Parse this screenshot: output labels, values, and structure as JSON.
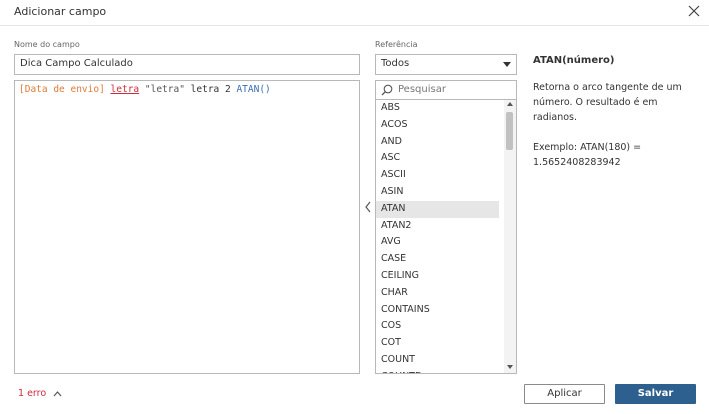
{
  "dialog": {
    "title": "Adicionar campo",
    "close_icon": "close-icon"
  },
  "field_name": {
    "label": "Nome do campo",
    "value": "Dica Campo Calculado"
  },
  "formula": {
    "tokens": [
      {
        "text": "[Data de envio]",
        "kind": "field"
      },
      {
        "text": "letra",
        "kind": "error"
      },
      {
        "text": "\"letra\"",
        "kind": "string"
      },
      {
        "text": "letra 2",
        "kind": "plain"
      },
      {
        "text": "ATAN()",
        "kind": "function"
      }
    ]
  },
  "reference": {
    "label": "Referência",
    "selected": "Todos",
    "search_placeholder": "Pesquisar",
    "functions": [
      "ABS",
      "ACOS",
      "AND",
      "ASC",
      "ASCII",
      "ASIN",
      "ATAN",
      "ATAN2",
      "AVG",
      "CASE",
      "CEILING",
      "CHAR",
      "CONTAINS",
      "COS",
      "COT",
      "COUNT",
      "COUNTD"
    ],
    "selected_function": "ATAN"
  },
  "help": {
    "title": "ATAN(número)",
    "body": "Retorna o arco tangente de um número.  O resultado é em radianos.\n\nExemplo: ATAN(180) = 1.5652408283942"
  },
  "footer": {
    "errors": "1 erro",
    "apply": "Aplicar",
    "save": "Salvar"
  },
  "colors": {
    "accent": "#2d5f8f",
    "error": "#d02b3b",
    "field": "#e07b3a",
    "function": "#3a6fb0"
  }
}
